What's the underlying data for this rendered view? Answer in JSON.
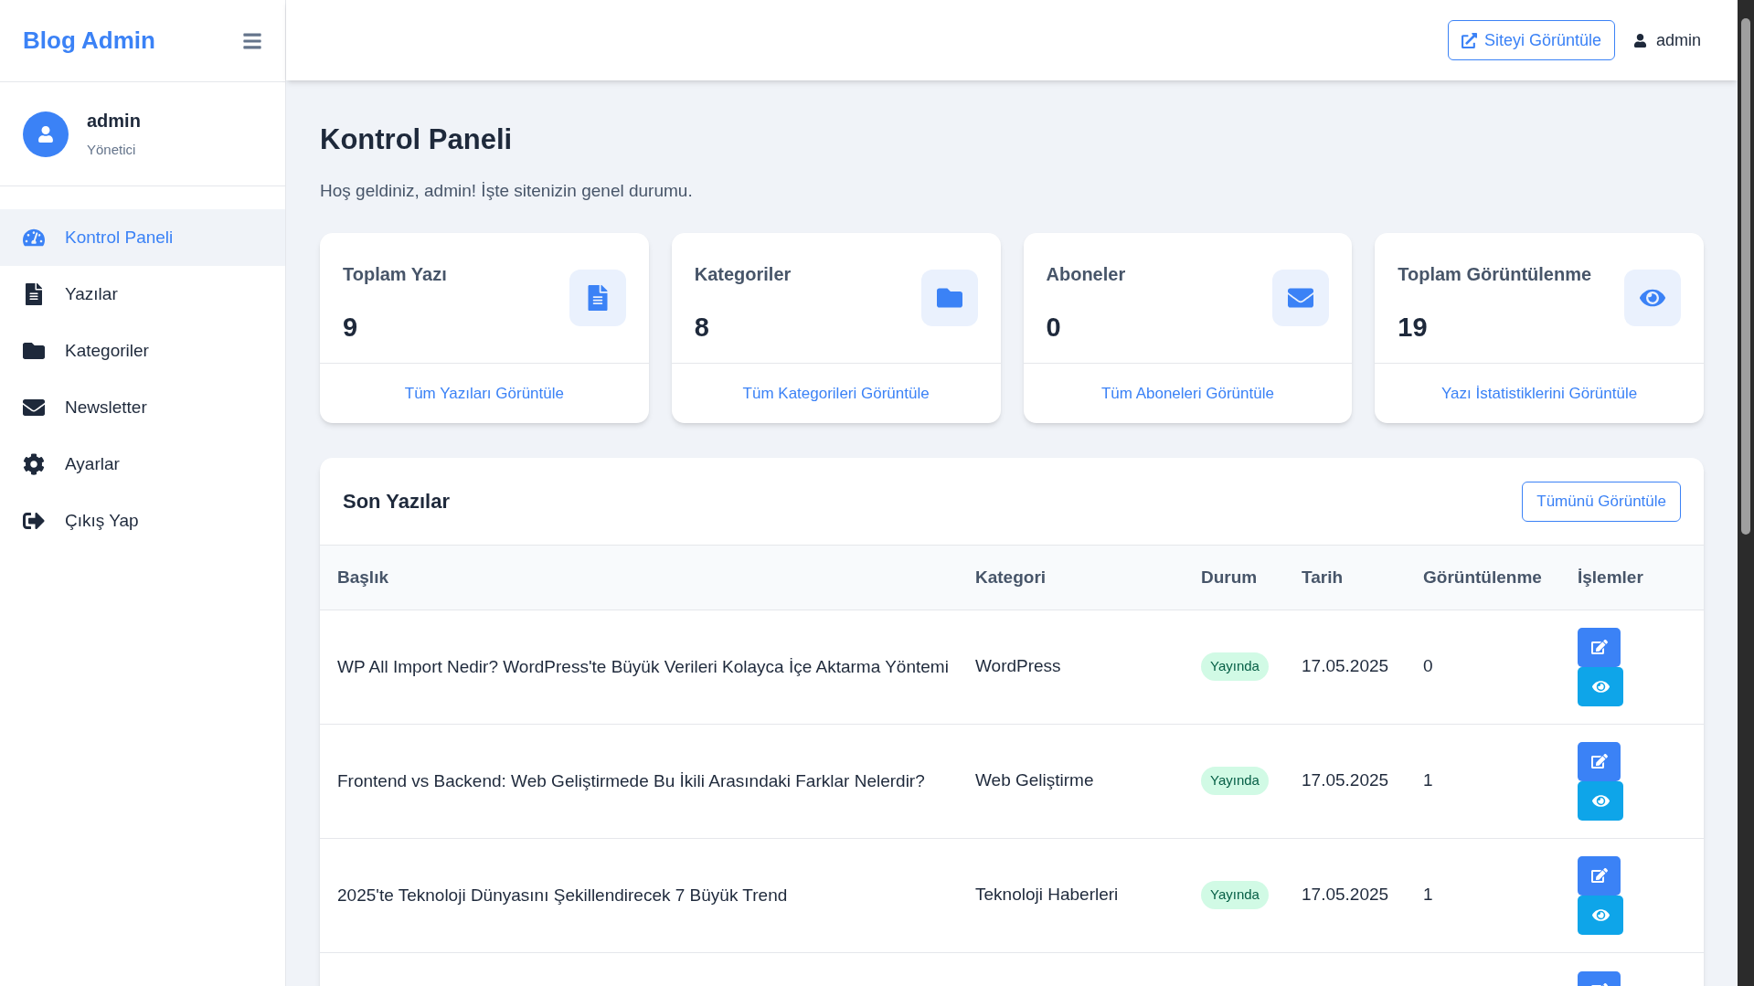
{
  "brand": "Blog Admin",
  "user": {
    "name": "admin",
    "role": "Yönetici"
  },
  "sidebar": {
    "items": [
      {
        "label": "Kontrol Paneli",
        "selected": true
      },
      {
        "label": "Yazılar",
        "selected": false
      },
      {
        "label": "Kategoriler",
        "selected": false
      },
      {
        "label": "Newsletter",
        "selected": false
      },
      {
        "label": "Ayarlar",
        "selected": false
      },
      {
        "label": "Çıkış Yap",
        "selected": false
      }
    ]
  },
  "header": {
    "site_button": "Siteyi Görüntüle",
    "user": "admin"
  },
  "page": {
    "title": "Kontrol Paneli",
    "subtitle": "Hoş geldiniz, admin! İşte sitenizin genel durumu."
  },
  "stats": [
    {
      "label": "Toplam Yazı",
      "value": "9",
      "link": "Tüm Yazıları Görüntüle"
    },
    {
      "label": "Kategoriler",
      "value": "8",
      "link": "Tüm Kategorileri Görüntüle"
    },
    {
      "label": "Aboneler",
      "value": "0",
      "link": "Tüm Aboneleri Görüntüle"
    },
    {
      "label": "Toplam Görüntülenme",
      "value": "19",
      "link": "Yazı İstatistiklerini Görüntüle"
    }
  ],
  "recent": {
    "title": "Son Yazılar",
    "button": "Tümünü Görüntüle",
    "columns": [
      "Başlık",
      "Kategori",
      "Durum",
      "Tarih",
      "Görüntülenme",
      "İşlemler"
    ],
    "rows": [
      {
        "title": "WP All Import Nedir? WordPress'te Büyük Verileri Kolayca İçe Aktarma Yöntemi",
        "category": "WordPress",
        "status": "Yayında",
        "date": "17.05.2025",
        "views": "0"
      },
      {
        "title": "Frontend vs Backend: Web Geliştirmede Bu İkili Arasındaki Farklar Nelerdir?",
        "category": "Web Geliştirme",
        "status": "Yayında",
        "date": "17.05.2025",
        "views": "1"
      },
      {
        "title": "2025'te Teknoloji Dünyasını Şekillendirecek 7 Büyük Trend",
        "category": "Teknoloji Haberleri",
        "status": "Yayında",
        "date": "17.05.2025",
        "views": "1"
      }
    ]
  }
}
